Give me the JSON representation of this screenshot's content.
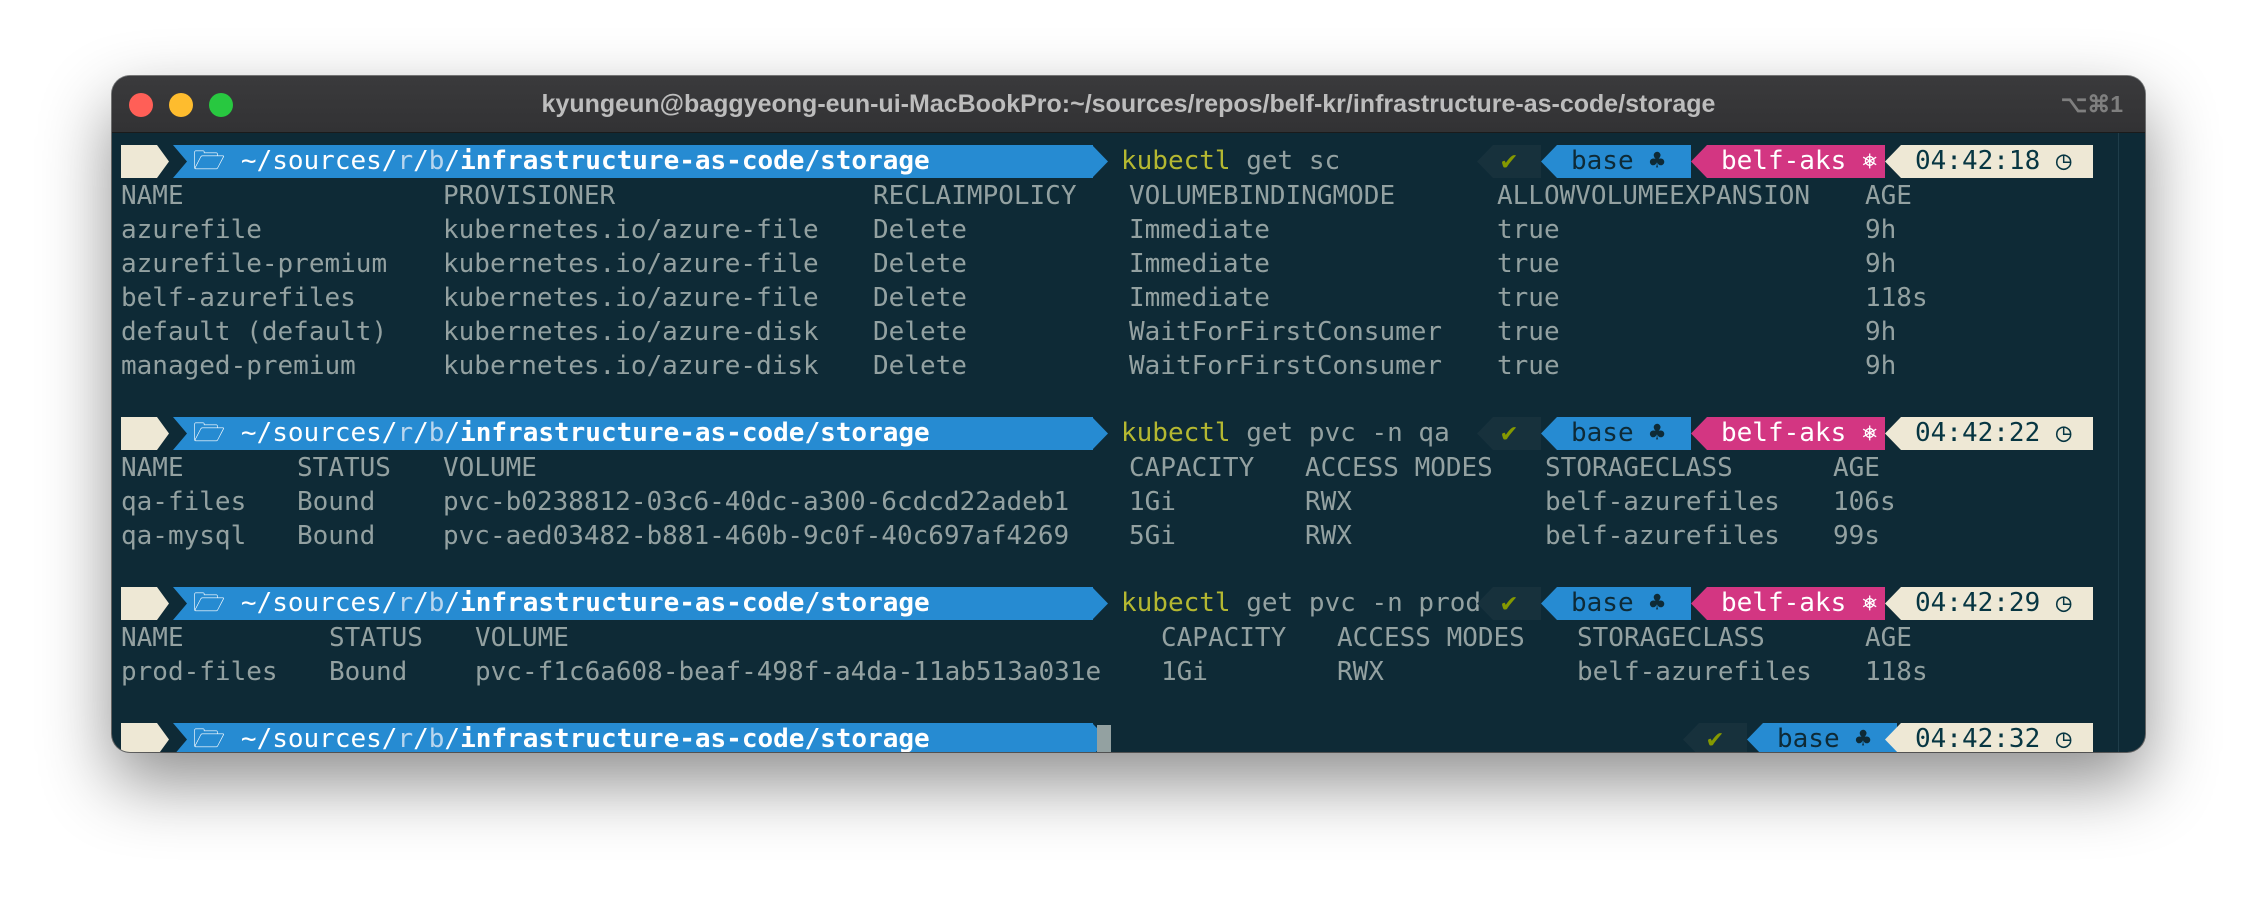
{
  "window": {
    "title": "kyungeun@baggyeong-eun-ui-MacBookPro:~/sources/repos/belf-kr/infrastructure-as-code/storage",
    "shortcut": "⌥⌘1"
  },
  "prompt": {
    "apple": "",
    "folder_icon": "🗁",
    "tilde": "~",
    "path_pre": "/sources/",
    "path_r": "r",
    "path_sep1": "/",
    "path_b": "b",
    "path_sep2": "/",
    "path_bold": "infrastructure-as-code/storage",
    "check": "✔",
    "env": "base",
    "env_icon": "♣",
    "cluster": "belf-aks",
    "cluster_icon": "⎈",
    "clock_icon": "◷"
  },
  "blocks": [
    {
      "command_name": "kubectl",
      "command_args": " get sc",
      "time": "04:42:18",
      "headers": [
        "NAME",
        "PROVISIONER",
        "RECLAIMPOLICY",
        "VOLUMEBINDINGMODE",
        "ALLOWVOLUMEEXPANSION",
        "AGE"
      ],
      "rows": [
        [
          "azurefile",
          "kubernetes.io/azure-file",
          "Delete",
          "Immediate",
          "true",
          "9h"
        ],
        [
          "azurefile-premium",
          "kubernetes.io/azure-file",
          "Delete",
          "Immediate",
          "true",
          "9h"
        ],
        [
          "belf-azurefiles",
          "kubernetes.io/azure-file",
          "Delete",
          "Immediate",
          "true",
          "118s"
        ],
        [
          "default (default)",
          "kubernetes.io/azure-disk",
          "Delete",
          "WaitForFirstConsumer",
          "true",
          "9h"
        ],
        [
          "managed-premium",
          "kubernetes.io/azure-disk",
          "Delete",
          "WaitForFirstConsumer",
          "true",
          "9h"
        ]
      ]
    },
    {
      "command_name": "kubectl",
      "command_args": " get pvc -n qa",
      "time": "04:42:22",
      "headers": [
        "NAME",
        "STATUS",
        "VOLUME",
        "CAPACITY",
        "ACCESS MODES",
        "STORAGECLASS",
        "AGE"
      ],
      "rows": [
        [
          "qa-files",
          "Bound",
          "pvc-b0238812-03c6-40dc-a300-6cdcd22adeb1",
          "1Gi",
          "RWX",
          "belf-azurefiles",
          "106s"
        ],
        [
          "qa-mysql",
          "Bound",
          "pvc-aed03482-b881-460b-9c0f-40c697af4269",
          "5Gi",
          "RWX",
          "belf-azurefiles",
          "99s"
        ]
      ]
    },
    {
      "command_name": "kubectl",
      "command_args": " get pvc -n prod",
      "time": "04:42:29",
      "headers": [
        "NAME",
        "STATUS",
        "VOLUME",
        "CAPACITY",
        "ACCESS MODES",
        "STORAGECLASS",
        "AGE"
      ],
      "rows": [
        [
          "prod-files",
          "Bound",
          "pvc-f1c6a608-beaf-498f-a4da-11ab513a031e",
          "1Gi",
          "RWX",
          "belf-azurefiles",
          "118s"
        ]
      ]
    }
  ],
  "final_prompt": {
    "time": "04:42:32"
  },
  "colors": {
    "background": "#0e2a36",
    "text": "#93a1a1",
    "path_segment": "#268bd2",
    "cluster_segment": "#d33682",
    "time_segment": "#eee8d5",
    "command": "#b5b831",
    "check": "#859900"
  }
}
